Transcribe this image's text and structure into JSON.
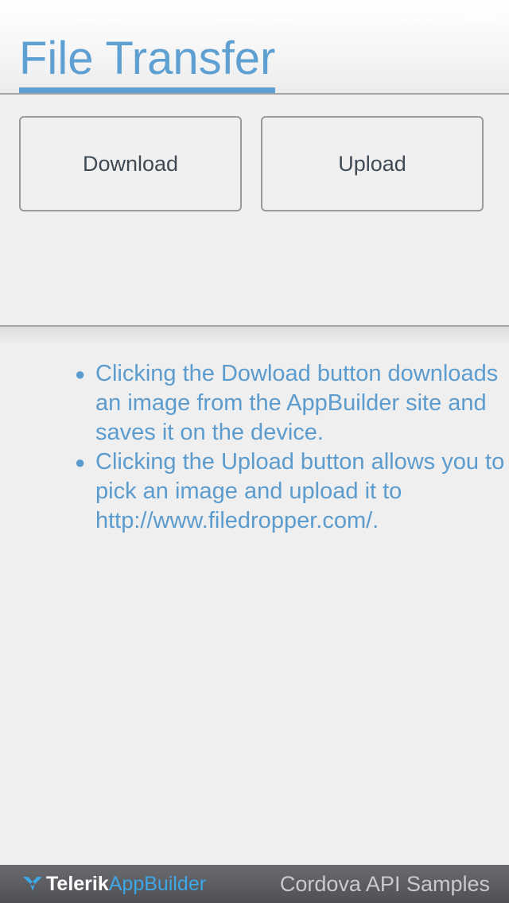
{
  "status_bar": {
    "signal": "●●●○○",
    "carrier": "Carrier",
    "wifi_icon": "wifi-icon",
    "time": "11:27 AM",
    "battery": "100 %",
    "battery_level": 1.0
  },
  "header": {
    "title": "File Transfer"
  },
  "actions": {
    "download_label": "Download",
    "upload_label": "Upload"
  },
  "info": {
    "items": [
      "Clicking the Dowload button downloads an image from the AppBuilder site and saves it on the device.",
      "Clicking the Upload button allows you to pick an image and upload it to http://www.filedropper.com/."
    ]
  },
  "footer": {
    "brand_part1": "Telerik",
    "brand_part2": "AppBuilder",
    "caption": "Cordova API Samples"
  },
  "colors": {
    "accent": "#5fa0d2",
    "text_info": "#5b9bcd",
    "footer_bg": "#58595d",
    "brand_blue": "#3da7e8"
  }
}
